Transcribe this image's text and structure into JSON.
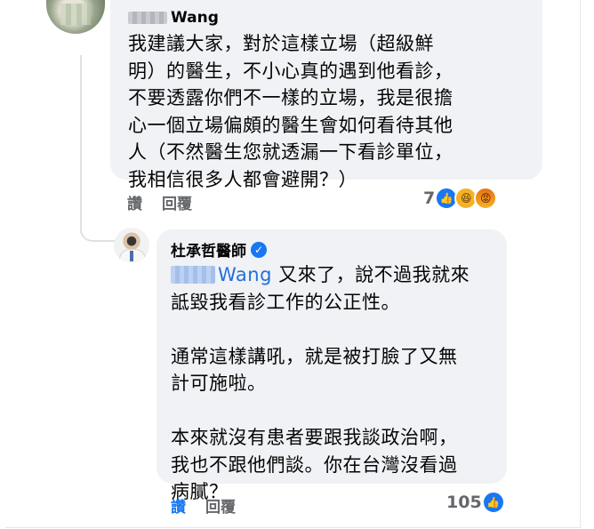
{
  "comment1": {
    "author_suffix": "Wang",
    "lines": [
      "我建議大家，對於這樣立場（超級鮮",
      "明）的醫生，不小心真的遇到他看診，",
      "不要透露你們不一樣的立場，我是很擔",
      "心一個立場偏頗的醫生會如何看待其他",
      "人（不然醫生您就透漏一下看診單位，",
      "我相信很多人都會避開？）"
    ],
    "actions": {
      "like": "讚",
      "reply": "回覆"
    },
    "reaction_count": "7",
    "reactions": [
      "like-icon",
      "haha-icon",
      "angry-icon"
    ]
  },
  "comment2": {
    "author": "杜承哲醫師",
    "mention_suffix": "Wang",
    "line1_rest": " 又來了，說不過我就來",
    "lines": [
      "詆毀我看診工作的公正性。",
      "",
      "通常這樣講吼，就是被打臉了又無",
      "計可施啦。",
      "",
      "本來就沒有患者要跟我談政治啊，",
      "我也不跟他們談。你在台灣沒看過",
      "病膩？"
    ],
    "actions": {
      "like": "讚",
      "reply": "回覆"
    },
    "reaction_count": "105",
    "reactions": [
      "like-icon"
    ]
  },
  "colors": {
    "bubble": "#f0f2f5",
    "link": "#216fdb",
    "like": "#1877f2",
    "meta": "#65676b"
  }
}
